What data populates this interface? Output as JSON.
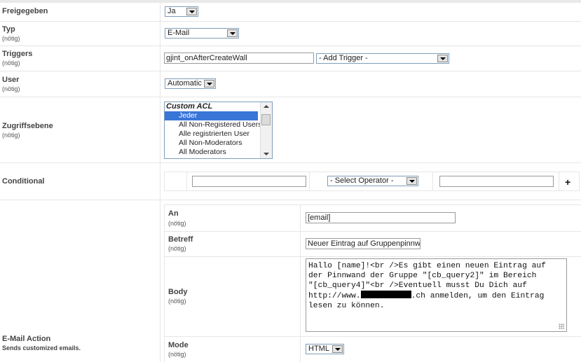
{
  "rows": {
    "freigegeben": {
      "label": "Freigegeben",
      "value": "Ja"
    },
    "typ": {
      "label": "Typ",
      "required": "(nötig)",
      "value": "E-Mail"
    },
    "triggers": {
      "label": "Triggers",
      "required": "(nötig)",
      "input_value": "gjint_onAfterCreateWall",
      "add_trigger": "- Add Trigger -"
    },
    "user": {
      "label": "User",
      "required": "(nötig)",
      "value": "Automatic"
    },
    "zugriff": {
      "label": "Zugriffsebene",
      "required": "(nötig)",
      "group": "Custom ACL",
      "items": [
        "Jeder",
        "All Non-Registered Users",
        "Alle registrierten User",
        "All Non-Moderators",
        "All Moderators"
      ],
      "selected": "Jeder"
    },
    "conditional": {
      "label": "Conditional",
      "operator": "- Select Operator -",
      "plus": "+"
    },
    "email_action": {
      "label": "E-Mail Action",
      "description": "Sends customized emails.",
      "an": {
        "label": "An",
        "required": "(nötig)",
        "value": "[email]"
      },
      "betreff": {
        "label": "Betreff",
        "required": "(nötig)",
        "value": "Neuer Eintrag auf Gruppenpinnwa"
      },
      "body": {
        "label": "Body",
        "required": "(nötig)",
        "line1": "Hallo [name]!<br />Es gibt einen neuen Eintrag auf",
        "line2": "der Pinnwand der Gruppe \"[cb_query2]\" im Bereich",
        "line3": "\"[cb_query4]\"<br />Eventuell musst Du Dich auf",
        "line4_start": "http://www.",
        "line4_end": ".ch anmelden, um den Eintrag",
        "line5": "lesen zu können."
      },
      "mode": {
        "label": "Mode",
        "required": "(nötig)",
        "value": "HTML"
      }
    }
  }
}
